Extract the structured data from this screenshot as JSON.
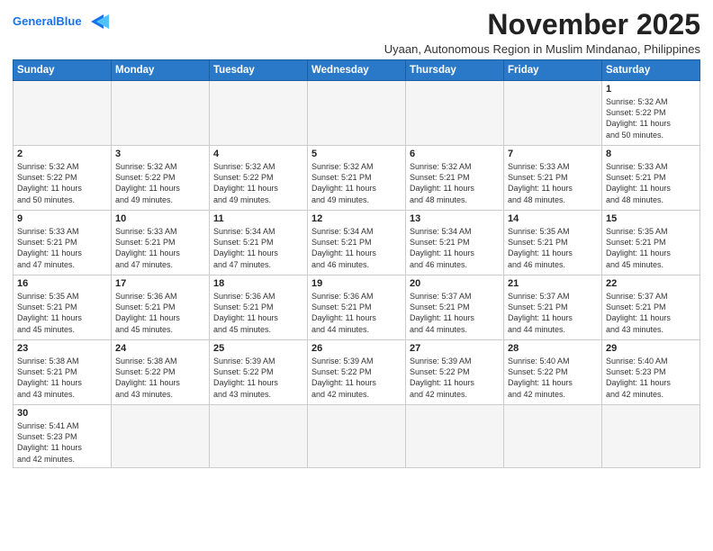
{
  "header": {
    "logo_general": "General",
    "logo_blue": "Blue",
    "month_title": "November 2025",
    "location": "Uyaan, Autonomous Region in Muslim Mindanao, Philippines"
  },
  "weekdays": [
    "Sunday",
    "Monday",
    "Tuesday",
    "Wednesday",
    "Thursday",
    "Friday",
    "Saturday"
  ],
  "weeks": [
    [
      {
        "day": "",
        "empty": true
      },
      {
        "day": "",
        "empty": true
      },
      {
        "day": "",
        "empty": true
      },
      {
        "day": "",
        "empty": true
      },
      {
        "day": "",
        "empty": true
      },
      {
        "day": "",
        "empty": true
      },
      {
        "day": "1",
        "sunrise": "5:32 AM",
        "sunset": "5:22 PM",
        "daylight": "11 hours and 50 minutes."
      }
    ],
    [
      {
        "day": "2",
        "sunrise": "5:32 AM",
        "sunset": "5:22 PM",
        "daylight": "11 hours and 50 minutes."
      },
      {
        "day": "3",
        "sunrise": "5:32 AM",
        "sunset": "5:22 PM",
        "daylight": "11 hours and 49 minutes."
      },
      {
        "day": "4",
        "sunrise": "5:32 AM",
        "sunset": "5:22 PM",
        "daylight": "11 hours and 49 minutes."
      },
      {
        "day": "5",
        "sunrise": "5:32 AM",
        "sunset": "5:21 PM",
        "daylight": "11 hours and 49 minutes."
      },
      {
        "day": "6",
        "sunrise": "5:32 AM",
        "sunset": "5:21 PM",
        "daylight": "11 hours and 48 minutes."
      },
      {
        "day": "7",
        "sunrise": "5:33 AM",
        "sunset": "5:21 PM",
        "daylight": "11 hours and 48 minutes."
      },
      {
        "day": "8",
        "sunrise": "5:33 AM",
        "sunset": "5:21 PM",
        "daylight": "11 hours and 48 minutes."
      }
    ],
    [
      {
        "day": "9",
        "sunrise": "5:33 AM",
        "sunset": "5:21 PM",
        "daylight": "11 hours and 47 minutes."
      },
      {
        "day": "10",
        "sunrise": "5:33 AM",
        "sunset": "5:21 PM",
        "daylight": "11 hours and 47 minutes."
      },
      {
        "day": "11",
        "sunrise": "5:34 AM",
        "sunset": "5:21 PM",
        "daylight": "11 hours and 47 minutes."
      },
      {
        "day": "12",
        "sunrise": "5:34 AM",
        "sunset": "5:21 PM",
        "daylight": "11 hours and 46 minutes."
      },
      {
        "day": "13",
        "sunrise": "5:34 AM",
        "sunset": "5:21 PM",
        "daylight": "11 hours and 46 minutes."
      },
      {
        "day": "14",
        "sunrise": "5:35 AM",
        "sunset": "5:21 PM",
        "daylight": "11 hours and 46 minutes."
      },
      {
        "day": "15",
        "sunrise": "5:35 AM",
        "sunset": "5:21 PM",
        "daylight": "11 hours and 45 minutes."
      }
    ],
    [
      {
        "day": "16",
        "sunrise": "5:35 AM",
        "sunset": "5:21 PM",
        "daylight": "11 hours and 45 minutes."
      },
      {
        "day": "17",
        "sunrise": "5:36 AM",
        "sunset": "5:21 PM",
        "daylight": "11 hours and 45 minutes."
      },
      {
        "day": "18",
        "sunrise": "5:36 AM",
        "sunset": "5:21 PM",
        "daylight": "11 hours and 45 minutes."
      },
      {
        "day": "19",
        "sunrise": "5:36 AM",
        "sunset": "5:21 PM",
        "daylight": "11 hours and 44 minutes."
      },
      {
        "day": "20",
        "sunrise": "5:37 AM",
        "sunset": "5:21 PM",
        "daylight": "11 hours and 44 minutes."
      },
      {
        "day": "21",
        "sunrise": "5:37 AM",
        "sunset": "5:21 PM",
        "daylight": "11 hours and 44 minutes."
      },
      {
        "day": "22",
        "sunrise": "5:37 AM",
        "sunset": "5:21 PM",
        "daylight": "11 hours and 43 minutes."
      }
    ],
    [
      {
        "day": "23",
        "sunrise": "5:38 AM",
        "sunset": "5:21 PM",
        "daylight": "11 hours and 43 minutes."
      },
      {
        "day": "24",
        "sunrise": "5:38 AM",
        "sunset": "5:22 PM",
        "daylight": "11 hours and 43 minutes."
      },
      {
        "day": "25",
        "sunrise": "5:39 AM",
        "sunset": "5:22 PM",
        "daylight": "11 hours and 43 minutes."
      },
      {
        "day": "26",
        "sunrise": "5:39 AM",
        "sunset": "5:22 PM",
        "daylight": "11 hours and 42 minutes."
      },
      {
        "day": "27",
        "sunrise": "5:39 AM",
        "sunset": "5:22 PM",
        "daylight": "11 hours and 42 minutes."
      },
      {
        "day": "28",
        "sunrise": "5:40 AM",
        "sunset": "5:22 PM",
        "daylight": "11 hours and 42 minutes."
      },
      {
        "day": "29",
        "sunrise": "5:40 AM",
        "sunset": "5:23 PM",
        "daylight": "11 hours and 42 minutes."
      }
    ],
    [
      {
        "day": "30",
        "sunrise": "5:41 AM",
        "sunset": "5:23 PM",
        "daylight": "11 hours and 42 minutes."
      },
      {
        "day": "",
        "empty": true
      },
      {
        "day": "",
        "empty": true
      },
      {
        "day": "",
        "empty": true
      },
      {
        "day": "",
        "empty": true
      },
      {
        "day": "",
        "empty": true
      },
      {
        "day": "",
        "empty": true
      }
    ]
  ],
  "labels": {
    "sunrise_prefix": "Sunrise: ",
    "sunset_prefix": "Sunset: ",
    "daylight_prefix": "Daylight: "
  }
}
